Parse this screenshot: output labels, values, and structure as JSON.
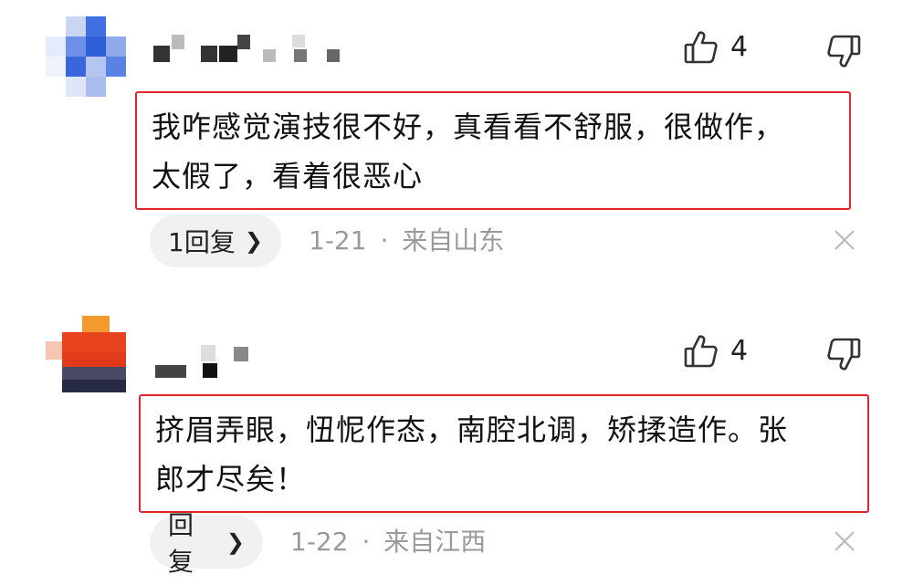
{
  "comments": [
    {
      "like_count": "4",
      "text": "我咋感觉演技很不好，真看看不舒服，很做作，\n太假了，看着很恶心",
      "reply_label": "1回复",
      "date": "1-21",
      "separator": "·",
      "location": "来自山东"
    },
    {
      "like_count": "4",
      "text": "挤眉弄眼，忸怩作态，南腔北调，矫揉造作。张\n郎才尽矣！",
      "reply_label": "回复",
      "date": "1-22",
      "separator": "·",
      "location": "来自江西"
    }
  ],
  "colors": {
    "highlight_border": "#e0252b",
    "meta_text": "#9a9a9a",
    "pill_bg": "#f1f1f1"
  }
}
